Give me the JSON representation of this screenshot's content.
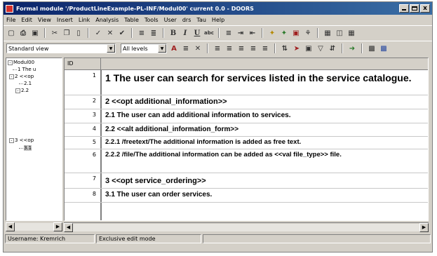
{
  "window": {
    "title": "Formal module '/ProductLineExample-PL-INF/Modul00' current 0.0 - DOORS",
    "buttons": {
      "minimize": "_",
      "maximize": "□",
      "close": "x"
    }
  },
  "menu": [
    "File",
    "Edit",
    "View",
    "Insert",
    "Link",
    "Analysis",
    "Table",
    "Tools",
    "User",
    "drs",
    "Tau",
    "Help"
  ],
  "toolbar": {
    "view_select": "Standard view",
    "level_select": "All levels"
  },
  "tree": {
    "root": "Modul00",
    "nodes": [
      "1 The u",
      "2 <<op",
      "2.1",
      "2.2",
      "3 <<op",
      "3.1"
    ]
  },
  "grid": {
    "id_header": "ID",
    "rows": [
      {
        "id": "1",
        "text": "1 The user can search for services listed in the service catalogue."
      },
      {
        "id": "2",
        "text": "2 <<opt additional_information>>"
      },
      {
        "id": "3",
        "text": "2.1 The user can add additional information to services."
      },
      {
        "id": "4",
        "text": "2.2 <<alt additional_information_form>>"
      },
      {
        "id": "5",
        "text": "2.2.1 /freetext/The additional information is added as free text."
      },
      {
        "id": "6",
        "text": "2.2.2 /file/The additional information can be added as <<val file_type>> file."
      },
      {
        "id": "7",
        "text": "3 <<opt service_ordering>>"
      },
      {
        "id": "8",
        "text": "3.1 The user can order services."
      }
    ]
  },
  "status": {
    "user": "Username: Kremrich",
    "mode": "Exclusive edit mode"
  }
}
